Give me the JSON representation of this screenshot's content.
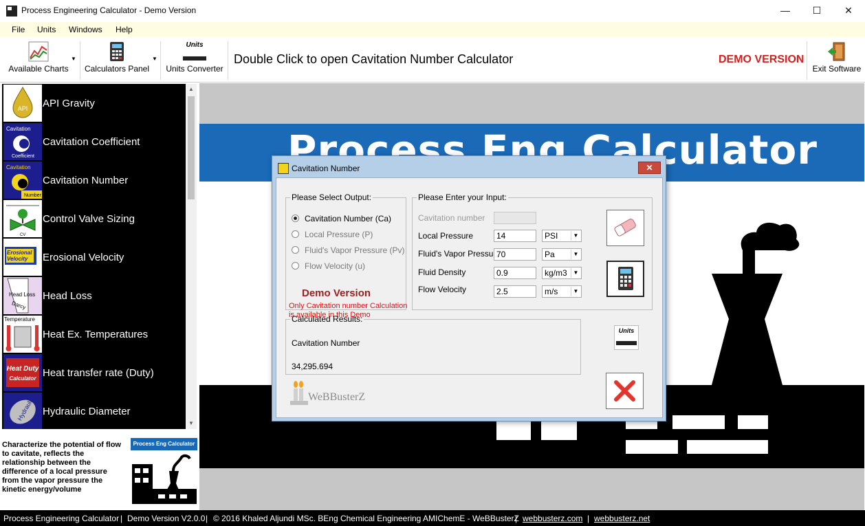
{
  "window": {
    "title": "Process Engineering Calculator - Demo Version",
    "minimize": "—",
    "maximize": "☐",
    "close": "✕"
  },
  "menu": [
    "File",
    "Units",
    "Windows",
    "Help"
  ],
  "toolbar": {
    "available_charts": "Available Charts",
    "calculators_panel": "Calculators Panel",
    "units_converter": "Units Converter",
    "hint": "Double Click to open Cavitation Number Calculator",
    "demo_badge": "DEMO VERSION",
    "exit": "Exit Software",
    "units_logo": "Units"
  },
  "calculators": [
    {
      "label": "API Gravity",
      "icon": "oil-drop-icon",
      "thumb_text": "API"
    },
    {
      "label": "Cavitation Coefficient",
      "icon": "cavitation-coefficient-icon",
      "thumb_text": "Cavitation",
      "thumb_text2": "Coefficient"
    },
    {
      "label": "Cavitation Number",
      "icon": "cavitation-number-icon",
      "thumb_text": "Cavitation",
      "thumb_text2": "Number"
    },
    {
      "label": "Control Valve Sizing",
      "icon": "control-valve-icon",
      "thumb_text": "CV"
    },
    {
      "label": "Erosional Velocity",
      "icon": "erosional-velocity-icon",
      "thumb_text": "Erosional",
      "thumb_text2": "Velocity"
    },
    {
      "label": "Head Loss",
      "icon": "head-loss-icon",
      "thumb_text": "Head Loss",
      "thumb_text2": "Darcy"
    },
    {
      "label": "Heat Ex. Temperatures",
      "icon": "thermometer-icon",
      "thumb_text": "Temperature"
    },
    {
      "label": "Heat transfer rate (Duty)",
      "icon": "heat-duty-icon",
      "thumb_text": "Heat Duty",
      "thumb_text2": "Calculator"
    },
    {
      "label": "Hydraulic Diameter",
      "icon": "hydraulic-diameter-icon",
      "thumb_text": "Hydraulic"
    }
  ],
  "description": "Characterize the potential of flow to cavitate, reflects the relationship between the difference of a local pressure from the vapor pressure  the kinetic energy/volume",
  "mini_logo_text": "Process Eng Calculator",
  "banner_text": "Process Eng Calculator",
  "dialog": {
    "title": "Cavitation Number",
    "close": "✕",
    "output_legend": "Please Select Output:",
    "outputs": [
      {
        "label": "Cavitation Number (Ca)",
        "selected": true
      },
      {
        "label": "Local Pressure (P)",
        "selected": false
      },
      {
        "label": "Fluid's Vapor Pressure (Pv)",
        "selected": false
      },
      {
        "label": "Flow Velocity (u)",
        "selected": false
      }
    ],
    "demo_title": "Demo Version",
    "demo_note": "Only Cavitation number Calculation is available in this Demo",
    "input_legend": "Please Enter your Input:",
    "inputs": [
      {
        "label": "Cavitation number",
        "value": "",
        "unit": null,
        "disabled": true
      },
      {
        "label": "Local Pressure",
        "value": "14",
        "unit": "PSI",
        "disabled": false
      },
      {
        "label": "Fluid's Vapor Pressure",
        "value": "70",
        "unit": "Pa",
        "disabled": false
      },
      {
        "label": "Fluid Density",
        "value": "0.9",
        "unit": "kg/m3",
        "disabled": false
      },
      {
        "label": "Flow Velocity",
        "value": "2.5",
        "unit": "m/s",
        "disabled": false
      }
    ],
    "results_legend": "Calculated Results:",
    "result_label": "Cavitation Number",
    "result_value": "34,295.694",
    "brand": "WeBBusterZ",
    "units_logo": "Units"
  },
  "status": {
    "app": "Process Engineering Calculator",
    "sep": "|",
    "version": "Demo Version V2.0.0",
    "copyright": "© 2016 Khaled Aljundi MSc. BEng Chemical Engineering AMIChemE - WeBBusterZ",
    "link1": "webbusterz.com",
    "link2": "webbusterz.net"
  },
  "colors": {
    "accent_blue": "#1a6ab8",
    "demo_red": "#d61e1e",
    "menubar_bg": "#fefce1"
  }
}
